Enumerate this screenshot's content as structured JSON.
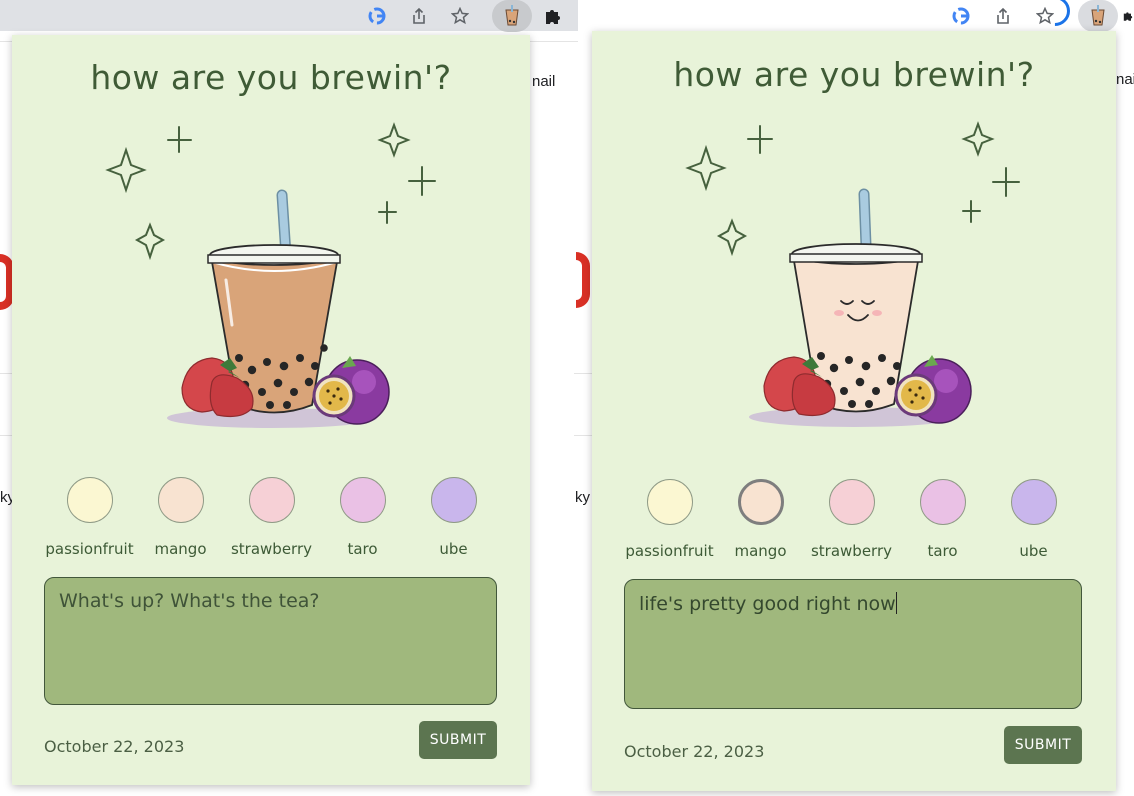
{
  "browser": {
    "toolbar_icons": [
      "google-icon",
      "share-icon",
      "bookmark-star-icon",
      "boba-extension-icon",
      "puzzle-extensions-icon"
    ]
  },
  "background_page": {
    "left_fragment_top": "nail",
    "left_fragment_mid": "ky",
    "right_fragment_top": "nai",
    "right_fragment_mid": "ky"
  },
  "popups": [
    {
      "title": "how are you brewin'?",
      "tea_color": "#d9a479",
      "face": false,
      "flavors": [
        {
          "label": "passionfruit",
          "color": "#fbf7d2",
          "selected": false
        },
        {
          "label": "mango",
          "color": "#f8e3d1",
          "selected": false
        },
        {
          "label": "strawberry",
          "color": "#f6d0d6",
          "selected": false
        },
        {
          "label": "taro",
          "color": "#eac1e5",
          "selected": false
        },
        {
          "label": "ube",
          "color": "#c9b6ec",
          "selected": false
        }
      ],
      "note": {
        "value": "",
        "placeholder": "What's up? What's the tea?"
      },
      "date": "October 22, 2023",
      "submit_label": "SUBMIT"
    },
    {
      "title": "how are you brewin'?",
      "tea_color": "#f8e3d1",
      "face": true,
      "flavors": [
        {
          "label": "passionfruit",
          "color": "#fbf7d2",
          "selected": false
        },
        {
          "label": "mango",
          "color": "#f8e3d1",
          "selected": true
        },
        {
          "label": "strawberry",
          "color": "#f6d0d6",
          "selected": false
        },
        {
          "label": "taro",
          "color": "#eac1e5",
          "selected": false
        },
        {
          "label": "ube",
          "color": "#c9b6ec",
          "selected": false
        }
      ],
      "note": {
        "value": "life's pretty good right now",
        "placeholder": "What's up? What's the tea?"
      },
      "date": "October 22, 2023",
      "submit_label": "SUBMIT"
    }
  ]
}
